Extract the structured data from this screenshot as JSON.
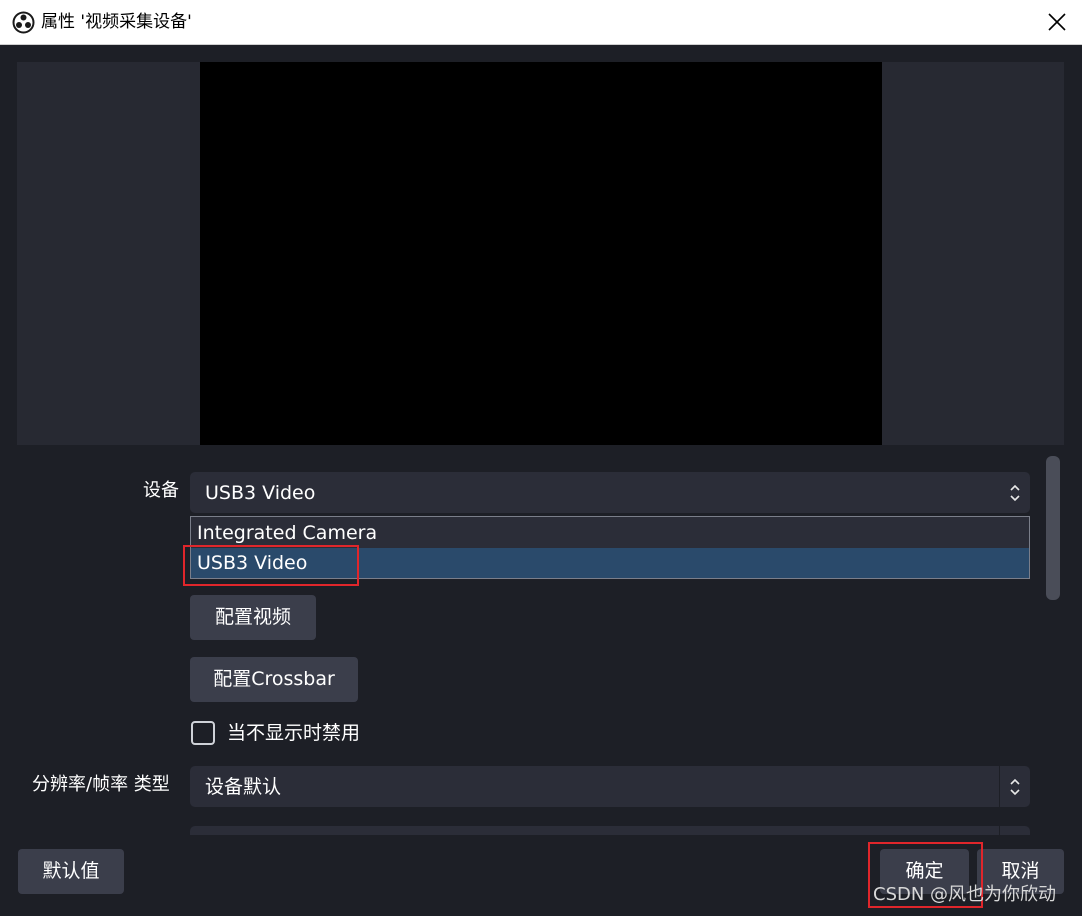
{
  "window": {
    "title": "属性 '视频采集设备'",
    "icons": {
      "app": "obs-logo-icon",
      "close": "close-icon"
    }
  },
  "form": {
    "device_label": "设备",
    "device_value": "USB3 Video",
    "device_options": [
      "Integrated Camera",
      "USB3 Video"
    ],
    "configure_video_label": "配置视频",
    "configure_crossbar_label": "配置Crossbar",
    "deactivate_label": "当不显示时禁用",
    "deactivate_checked": false,
    "resolution_label": "分辨率/帧率 类型",
    "resolution_value": "设备默认"
  },
  "footer": {
    "defaults_label": "默认值",
    "ok_label": "确定",
    "cancel_label": "取消"
  },
  "watermark": "CSDN @风也为你欣动",
  "colors": {
    "background": "#1d1f26",
    "combo": "#2b2d38",
    "button": "#3b3e4b",
    "selection": "#2a4a6b",
    "highlight": "#e0262b"
  }
}
